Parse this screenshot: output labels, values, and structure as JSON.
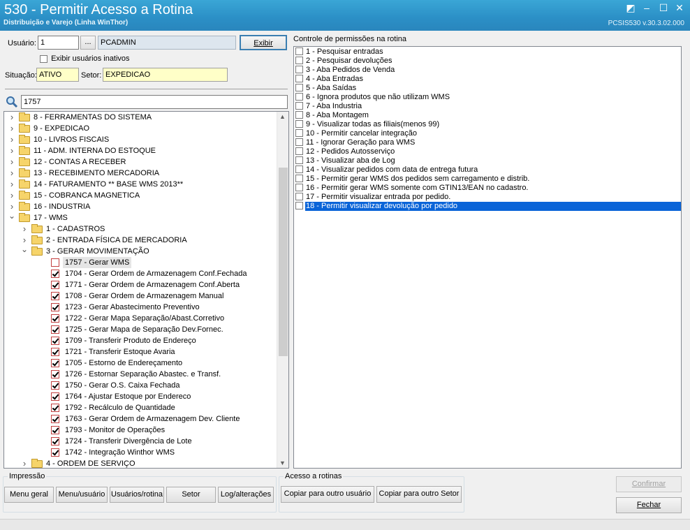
{
  "window": {
    "title": "530 - Permitir Acesso a Rotina",
    "subtitle": "Distribuição e Varejo (Linha WinThor)",
    "version": "PCSIS530  v.30.3.02.000"
  },
  "user": {
    "label": "Usuário:",
    "id": "1",
    "lookup_button": "...",
    "name": "PCADMIN",
    "show_button": "Exibir",
    "inactive_checkbox_label": "Exibir usuários inativos"
  },
  "status": {
    "label": "Situação:",
    "value": "ATIVO"
  },
  "sector": {
    "label": "Setor:",
    "value": "EXPEDICAO"
  },
  "search": {
    "value": "1757"
  },
  "tree": [
    {
      "label": "8 - FERRAMENTAS DO SISTEMA",
      "type": "folder",
      "level": 0,
      "expanded": false
    },
    {
      "label": "9 - EXPEDICAO",
      "type": "folder",
      "level": 0,
      "expanded": false
    },
    {
      "label": "10 - LIVROS FISCAIS",
      "type": "folder",
      "level": 0,
      "expanded": false
    },
    {
      "label": "11 - ADM. INTERNA DO ESTOQUE",
      "type": "folder",
      "level": 0,
      "expanded": false
    },
    {
      "label": "12 - CONTAS A RECEBER",
      "type": "folder",
      "level": 0,
      "expanded": false
    },
    {
      "label": "13 - RECEBIMENTO MERCADORIA",
      "type": "folder",
      "level": 0,
      "expanded": false
    },
    {
      "label": "14 - FATURAMENTO  ** BASE WMS 2013**",
      "type": "folder",
      "level": 0,
      "expanded": false
    },
    {
      "label": "15 - COBRANCA MAGNETICA",
      "type": "folder",
      "level": 0,
      "expanded": false
    },
    {
      "label": "16 - INDUSTRIA",
      "type": "folder",
      "level": 0,
      "expanded": false
    },
    {
      "label": "17 - WMS",
      "type": "folder",
      "level": 0,
      "expanded": true
    },
    {
      "label": "1 - CADASTROS",
      "type": "folder",
      "level": 1,
      "expanded": false
    },
    {
      "label": "2 - ENTRADA FÍSICA DE MERCADORIA",
      "type": "folder",
      "level": 1,
      "expanded": false
    },
    {
      "label": "3 - GERAR MOVIMENTAÇÃO",
      "type": "folder",
      "level": 1,
      "expanded": true
    },
    {
      "label": "1757 - Gerar WMS",
      "type": "item",
      "level": 2,
      "checked": false,
      "highlighted": true
    },
    {
      "label": "1704 - Gerar Ordem de Armazenagem Conf.Fechada",
      "type": "item",
      "level": 2,
      "checked": true
    },
    {
      "label": "1771 - Gerar Ordem de Armazenagem Conf.Aberta",
      "type": "item",
      "level": 2,
      "checked": true
    },
    {
      "label": "1708 - Gerar Ordem de Armazenagem Manual",
      "type": "item",
      "level": 2,
      "checked": true
    },
    {
      "label": "1723 - Gerar Abastecimento Preventivo",
      "type": "item",
      "level": 2,
      "checked": true
    },
    {
      "label": "1722 - Gerar Mapa Separação/Abast.Corretivo",
      "type": "item",
      "level": 2,
      "checked": true
    },
    {
      "label": "1725 - Gerar Mapa de Separação Dev.Fornec.",
      "type": "item",
      "level": 2,
      "checked": true
    },
    {
      "label": "1709 - Transferir Produto de Endereço",
      "type": "item",
      "level": 2,
      "checked": true
    },
    {
      "label": "1721 - Transferir Estoque Avaria",
      "type": "item",
      "level": 2,
      "checked": true
    },
    {
      "label": "1705 - Estorno de Endereçamento",
      "type": "item",
      "level": 2,
      "checked": true
    },
    {
      "label": "1726 - Estornar Separação Abastec. e Transf.",
      "type": "item",
      "level": 2,
      "checked": true
    },
    {
      "label": "1750 - Gerar O.S. Caixa Fechada",
      "type": "item",
      "level": 2,
      "checked": true
    },
    {
      "label": "1764 - Ajustar Estoque por Endereco",
      "type": "item",
      "level": 2,
      "checked": true
    },
    {
      "label": "1792 - Recálculo de Quantidade",
      "type": "item",
      "level": 2,
      "checked": true
    },
    {
      "label": "1763 - Gerar Ordem de Armazenagem Dev. Cliente",
      "type": "item",
      "level": 2,
      "checked": true
    },
    {
      "label": "1793 - Monitor de Operações",
      "type": "item",
      "level": 2,
      "checked": true
    },
    {
      "label": "1724 - Transferir Divergência de Lote",
      "type": "item",
      "level": 2,
      "checked": true
    },
    {
      "label": "1742 - Integração Winthor WMS",
      "type": "item",
      "level": 2,
      "checked": true
    },
    {
      "label": "4 - ORDEM DE SERVIÇO",
      "type": "folder",
      "level": 1,
      "expanded": false
    }
  ],
  "permissions": {
    "title": "Controle de permissões na rotina",
    "items": [
      {
        "label": "1 - Pesquisar entradas",
        "checked": false
      },
      {
        "label": "2 - Pesquisar devoluções",
        "checked": false
      },
      {
        "label": "3 - Aba Pedidos de Venda",
        "checked": false
      },
      {
        "label": "4 - Aba Entradas",
        "checked": false
      },
      {
        "label": "5 - Aba Saídas",
        "checked": false
      },
      {
        "label": "6 - Ignora produtos que não utilizam WMS",
        "checked": false
      },
      {
        "label": "7 - Aba Industria",
        "checked": false
      },
      {
        "label": "8 - Aba Montagem",
        "checked": false
      },
      {
        "label": "9 - Visualizar todas as filiais(menos 99)",
        "checked": false
      },
      {
        "label": "10 - Permitir cancelar integração",
        "checked": false
      },
      {
        "label": "11 - Ignorar Geração para WMS",
        "checked": false
      },
      {
        "label": "12 - Pedidos Autosserviço",
        "checked": false
      },
      {
        "label": "13 - Visualizar aba de Log",
        "checked": false
      },
      {
        "label": "14 - Visualizar pedidos com data de entrega futura",
        "checked": false
      },
      {
        "label": "15 - Permitir gerar WMS dos pedidos sem carregamento e distrib.",
        "checked": false
      },
      {
        "label": "16 - Permitir gerar WMS somente com GTIN13/EAN no cadastro.",
        "checked": false
      },
      {
        "label": "17 - Permitir visualizar entrada por pedido.",
        "checked": false
      },
      {
        "label": "18 - Permitir visualizar devolução por pedido",
        "checked": false,
        "selected": true
      }
    ]
  },
  "impressao": {
    "title": "Impressão",
    "buttons": [
      "Menu geral",
      "Menu/usuário",
      "Usuários/rotina",
      "Setor",
      "Log/alterações"
    ]
  },
  "acesso": {
    "title": "Acesso a rotinas",
    "buttons": [
      "Copiar para outro usuário",
      "Copiar para outro Setor"
    ]
  },
  "actions": {
    "confirm": "Confirmar",
    "close": "Fechar"
  },
  "colors": {
    "titlebar": "#2b8fc6",
    "selection": "#0a64d8",
    "input_yellow": "#ffffc8",
    "checkbox_red": "#c24040"
  }
}
